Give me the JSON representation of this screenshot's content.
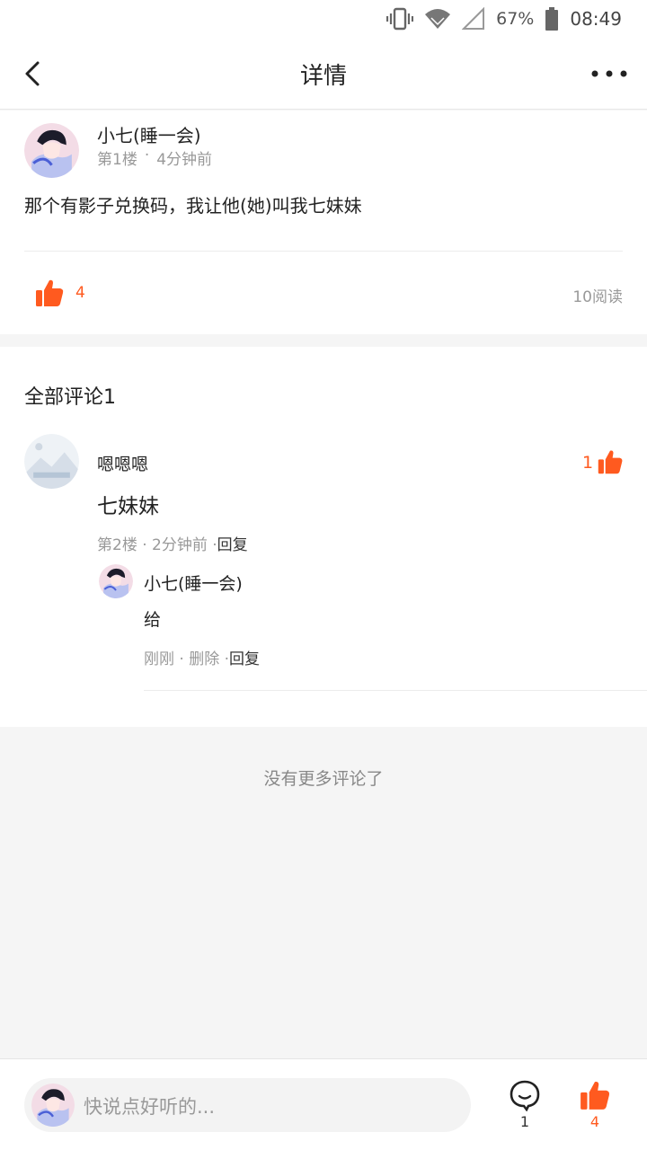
{
  "status_bar": {
    "battery": "67%",
    "time": "08:49"
  },
  "header": {
    "title": "详情"
  },
  "post": {
    "author": "小七(睡一会)",
    "floor": "第1楼",
    "separator": "·",
    "time": "4分钟前",
    "content": "那个有影子兑换码，我让他(她)叫我七妹妹",
    "like_count": "4",
    "reads": "10阅读"
  },
  "comments": {
    "heading": "全部评论1",
    "items": [
      {
        "author": "嗯嗯嗯",
        "like_count": "1",
        "text": "七妹妹",
        "meta": "第2楼 · 2分钟前 ·",
        "reply_label": "回复",
        "replies": [
          {
            "author": "小七(睡一会)",
            "text": "给",
            "meta": "刚刚 · 删除 · ",
            "reply_label": "回复"
          }
        ]
      }
    ]
  },
  "footer_note": "没有更多评论了",
  "bottom_bar": {
    "placeholder": "快说点好听的...",
    "comment_count": "1",
    "like_count": "4"
  },
  "colors": {
    "accent": "#ff5a1f"
  }
}
